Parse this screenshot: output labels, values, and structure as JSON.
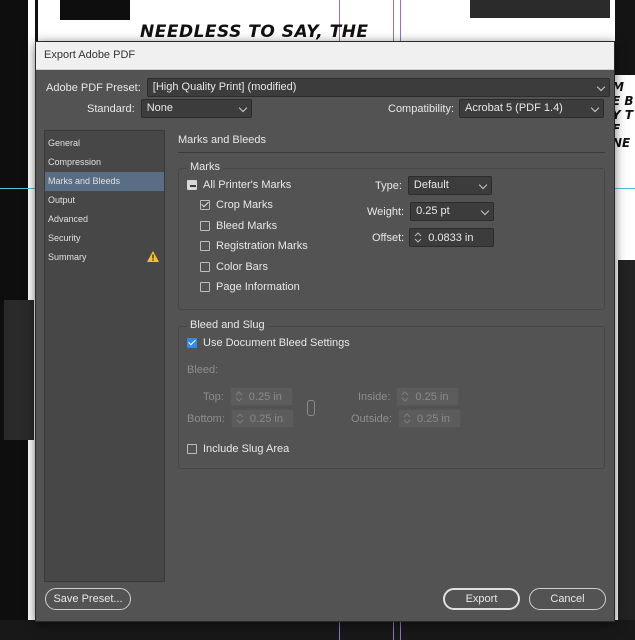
{
  "background": {
    "comic_text": "NEEDLESS TO SAY, THE",
    "side_text": "M E B Y T F NE"
  },
  "dialog": {
    "title": "Export Adobe PDF",
    "preset_label": "Adobe PDF Preset:",
    "preset_value": "[High Quality Print] (modified)",
    "standard_label": "Standard:",
    "standard_value": "None",
    "compat_label": "Compatibility:",
    "compat_value": "Acrobat 5 (PDF 1.4)"
  },
  "sidebar": {
    "items": [
      {
        "label": "General"
      },
      {
        "label": "Compression"
      },
      {
        "label": "Marks and Bleeds"
      },
      {
        "label": "Output"
      },
      {
        "label": "Advanced"
      },
      {
        "label": "Security"
      },
      {
        "label": "Summary"
      }
    ],
    "active_index": 2
  },
  "panel": {
    "title": "Marks and Bleeds",
    "marks": {
      "group_title": "Marks",
      "all_printers_marks": "All Printer's Marks",
      "crop_marks": "Crop Marks",
      "bleed_marks": "Bleed Marks",
      "registration_marks": "Registration Marks",
      "color_bars": "Color Bars",
      "page_information": "Page Information",
      "type_label": "Type:",
      "type_value": "Default",
      "weight_label": "Weight:",
      "weight_value": "0.25 pt",
      "offset_label": "Offset:",
      "offset_value": "0.0833 in"
    },
    "bleed": {
      "group_title": "Bleed and Slug",
      "use_doc_bleed": "Use Document Bleed Settings",
      "bleed_label": "Bleed:",
      "top_label": "Top:",
      "top_value": "0.25 in",
      "bottom_label": "Bottom:",
      "bottom_value": "0.25 in",
      "inside_label": "Inside:",
      "inside_value": "0.25 in",
      "outside_label": "Outside:",
      "outside_value": "0.25 in",
      "include_slug": "Include Slug Area"
    }
  },
  "buttons": {
    "save_preset": "Save Preset...",
    "export": "Export",
    "cancel": "Cancel"
  },
  "colors": {
    "dialog_bg": "#535353",
    "selection": "#596d84",
    "checkbox_blue": "#2d8ceb",
    "warning": "#f2c230"
  }
}
